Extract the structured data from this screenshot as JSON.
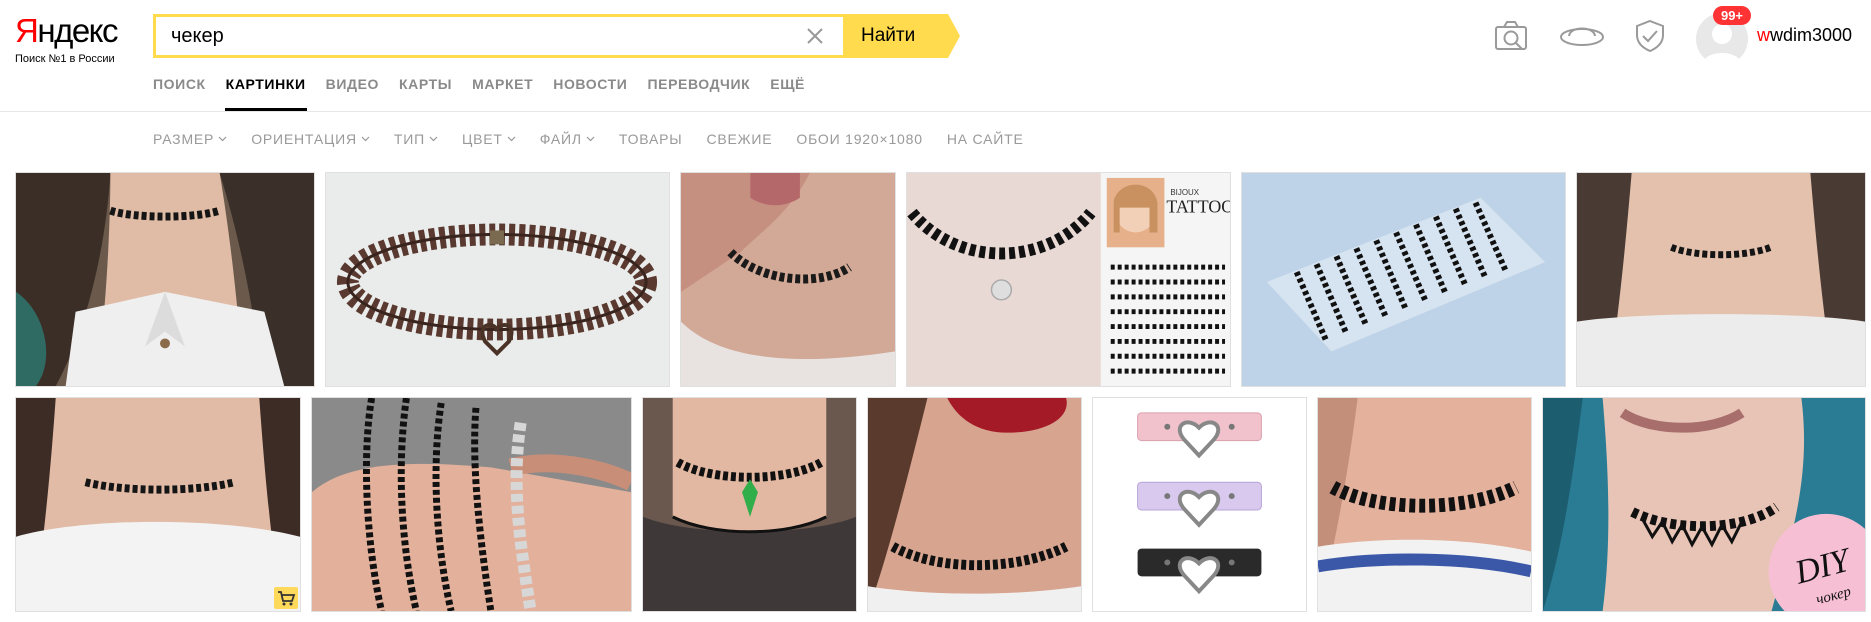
{
  "logo": {
    "first_letter": "Я",
    "rest": "ндекс",
    "tagline": "Поиск №1 в России"
  },
  "search": {
    "query": "чекер",
    "button_label": "Найти"
  },
  "nav": [
    {
      "label": "Поиск",
      "active": false
    },
    {
      "label": "Картинки",
      "active": true
    },
    {
      "label": "Видео",
      "active": false
    },
    {
      "label": "Карты",
      "active": false
    },
    {
      "label": "Маркет",
      "active": false
    },
    {
      "label": "Новости",
      "active": false
    },
    {
      "label": "Переводчик",
      "active": false
    },
    {
      "label": "Ещё",
      "active": false
    }
  ],
  "user": {
    "badge": "99+",
    "name_first": "w",
    "name_rest": "wdim3000"
  },
  "filters": [
    {
      "label": "Размер",
      "dropdown": true
    },
    {
      "label": "Ориентация",
      "dropdown": true
    },
    {
      "label": "Тип",
      "dropdown": true
    },
    {
      "label": "Цвет",
      "dropdown": true
    },
    {
      "label": "Файл",
      "dropdown": true
    },
    {
      "label": "Товары",
      "dropdown": false
    },
    {
      "label": "Свежие",
      "dropdown": false
    },
    {
      "label": "Обои 1920×1080",
      "dropdown": false
    },
    {
      "label": "На сайте",
      "dropdown": false
    }
  ],
  "tattoo_card": {
    "brand": "BIJOUX",
    "title": "TATTOO"
  },
  "diy_badge": {
    "big": "DIY",
    "small": "чокер"
  },
  "colors": {
    "accent_yellow": "#ffdb4d",
    "brand_red": "#ff0000",
    "badge_red": "#ff3333",
    "nav_muted": "#8a8a8a",
    "filter_muted": "#999999"
  }
}
